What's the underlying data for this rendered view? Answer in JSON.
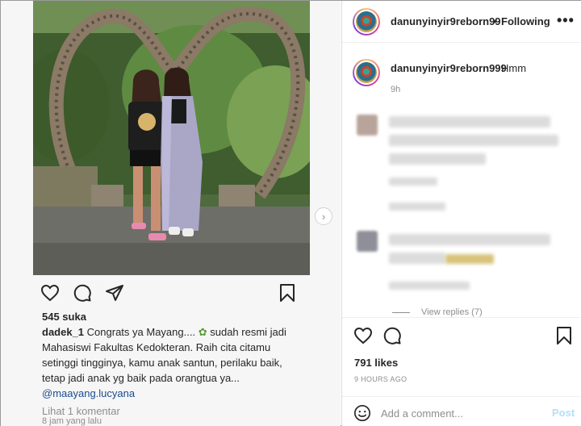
{
  "embed": {
    "likes": "545 suka",
    "caption_user": "dadek_1",
    "caption_lines": [
      "Congrats ya Mayang....",
      "sudah resmi jadi",
      "Mahasiswi Fakultas Kedokteran. Raih cita citamu",
      "setinggi tingginya, kamu anak santun, perilaku baik,",
      "tetap jadi anak yg baik pada orangtua ya..."
    ],
    "mention": "@maayang.lucyana",
    "view_comments": "Lihat 1 komentar",
    "time": "8 jam yang lalu"
  },
  "post": {
    "username": "danunyinyir9reborn99",
    "dot": "•",
    "follow_label": "Following",
    "more_label": "•••",
    "caption_user": "danunyinyir9reborn999",
    "caption_text": "Hmm",
    "caption_time": "9h",
    "view_replies": "View replies (7)",
    "likes": "791 likes",
    "time": "9 HOURS AGO",
    "comment_placeholder": "Add a comment...",
    "post_label": "Post"
  },
  "next_arrow": "›",
  "icons": {
    "heart": "heart-icon",
    "comment": "comment-icon",
    "share": "share-icon",
    "bookmark": "bookmark-icon",
    "emoji": "emoji-icon"
  },
  "colors": {
    "link": "#1c4b8c",
    "muted": "#8e8e8e",
    "post_button": "#b2dffc"
  }
}
